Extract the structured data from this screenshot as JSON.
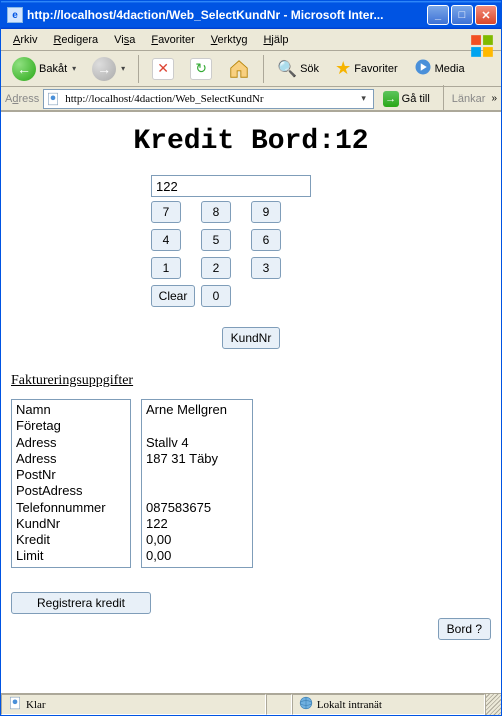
{
  "window": {
    "title": "http://localhost/4daction/Web_SelectKundNr - Microsoft Inter..."
  },
  "menu": {
    "arkiv": "Arkiv",
    "redigera": "Redigera",
    "visa": "Visa",
    "favoriter": "Favoriter",
    "verktyg": "Verktyg",
    "hjalp": "Hjälp"
  },
  "toolbar": {
    "back": "Bakåt",
    "sok": "Sök",
    "favoriter": "Favoriter",
    "media": "Media"
  },
  "address": {
    "label": "Adress",
    "url": "http://localhost/4daction/Web_SelectKundNr",
    "go": "Gå till",
    "links": "Länkar"
  },
  "page": {
    "title": "Kredit Bord:12",
    "input_value": "122",
    "keys": {
      "k7": "7",
      "k8": "8",
      "k9": "9",
      "k4": "4",
      "k5": "5",
      "k6": "6",
      "k1": "1",
      "k2": "2",
      "k3": "3",
      "clear": "Clear",
      "k0": "0"
    },
    "kundnr_btn": "KundNr",
    "section_head": "Faktureringsuppgifter",
    "labels": {
      "namn": "Namn",
      "foretag": "Företag",
      "adress1": "Adress",
      "adress2": "Adress",
      "postnr": "PostNr",
      "postadress": "PostAdress",
      "telefon": "Telefonnummer",
      "kundnr": "KundNr",
      "kredit": "Kredit",
      "limit": "Limit"
    },
    "values": {
      "namn": "Arne Mellgren",
      "foretag": "",
      "adress1": "Stallv 4",
      "adress2": "187 31 Täby",
      "postnr": "",
      "postadress": "",
      "telefon": "087583675",
      "kundnr": "122",
      "kredit": "0,00",
      "limit": "0,00"
    },
    "reg_btn": "Registrera kredit",
    "bord_btn": "Bord ?"
  },
  "status": {
    "left": "Klar",
    "right": "Lokalt intranät"
  }
}
